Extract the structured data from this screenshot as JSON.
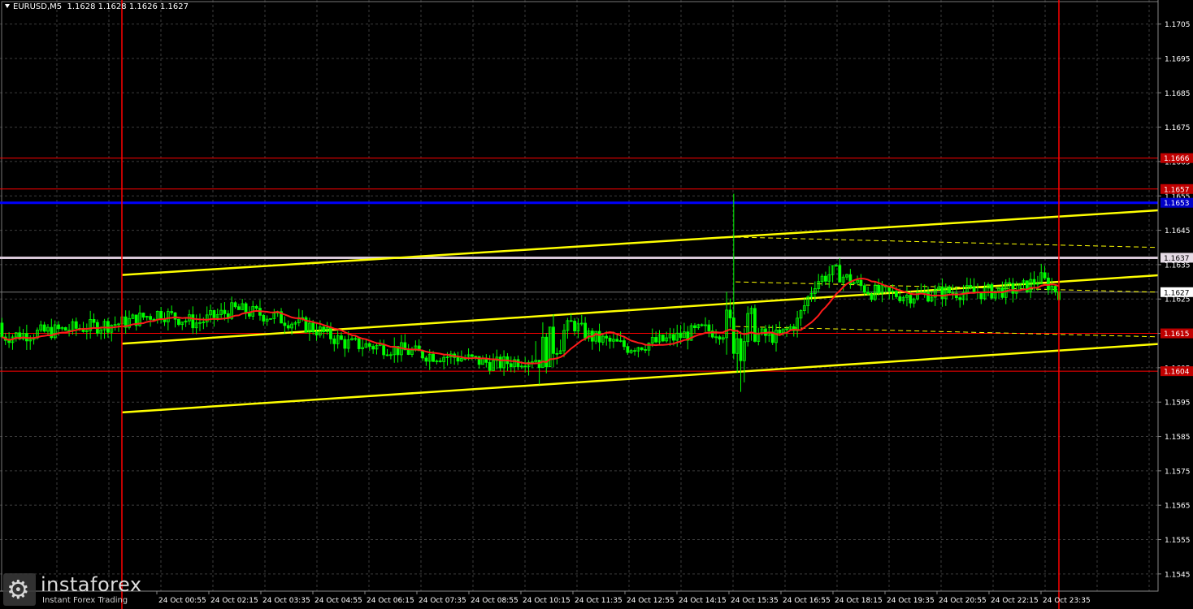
{
  "header": {
    "symbol": "EURUSD,M5",
    "ohlc": "1.1628 1.1628 1.1626 1.1627"
  },
  "logo": {
    "name": "instaforex",
    "tagline": "Instant Forex Trading"
  },
  "colors": {
    "background": "#000000",
    "grid": "#3c3c3c",
    "candle": "#00ff00",
    "moving_average": "#ff1a1a",
    "channel": "#ffff00",
    "level_red": "#ff0000",
    "level_blue": "#0000ff",
    "level_white": "#d8c8d8",
    "session_line": "#ff0000",
    "axis_text": "#ffffff"
  },
  "chart_data": {
    "type": "candlestick",
    "symbol": "EURUSD",
    "timeframe": "M5",
    "ylim": [
      1.154,
      1.1712
    ],
    "grid": true,
    "y_ticks": [
      "1.1705",
      "1.1695",
      "1.1685",
      "1.1675",
      "1.1665",
      "1.1655",
      "1.1645",
      "1.1635",
      "1.1625",
      "1.1615",
      "1.1605",
      "1.1595",
      "1.1585",
      "1.1575",
      "1.1565",
      "1.1555",
      "1.1545"
    ],
    "x_ticks": [
      "24 Oct 00:55",
      "24 Oct 02:15",
      "24 Oct 03:35",
      "24 Oct 04:55",
      "24 Oct 06:15",
      "24 Oct 07:35",
      "24 Oct 08:55",
      "24 Oct 10:15",
      "24 Oct 11:35",
      "24 Oct 12:55",
      "24 Oct 14:15",
      "24 Oct 15:35",
      "24 Oct 16:55",
      "24 Oct 18:15",
      "24 Oct 19:35",
      "24 Oct 20:55",
      "24 Oct 22:15",
      "24 Oct 23:35"
    ],
    "levels": [
      {
        "price": 1.1666,
        "label": "1.1666",
        "kind": "red"
      },
      {
        "price": 1.1657,
        "label": "1.1657",
        "kind": "red"
      },
      {
        "price": 1.1653,
        "label": "1.1653",
        "kind": "blue"
      },
      {
        "price": 1.1637,
        "label": "1.1637",
        "kind": "white"
      },
      {
        "price": 1.1627,
        "label": "1.1627",
        "kind": "current"
      },
      {
        "price": 1.1615,
        "label": "1.1615",
        "kind": "red"
      },
      {
        "price": 1.1604,
        "label": "1.1604",
        "kind": "red"
      }
    ],
    "channel_lines": [
      {
        "from": [
          0.0,
          1.1632
        ],
        "to": [
          1.0,
          1.1649
        ]
      },
      {
        "from": [
          0.0,
          1.1612
        ],
        "to": [
          1.0,
          1.163
        ]
      },
      {
        "from": [
          0.0,
          1.1592
        ],
        "to": [
          1.0,
          1.161
        ]
      }
    ],
    "session_markers": [
      0.0,
      1.0
    ],
    "price_path": [
      [
        0.0,
        1.1618
      ],
      [
        0.04,
        1.1621
      ],
      [
        0.08,
        1.1618
      ],
      [
        0.12,
        1.1622
      ],
      [
        0.16,
        1.162
      ],
      [
        0.2,
        1.1617
      ],
      [
        0.24,
        1.1612
      ],
      [
        0.28,
        1.1611
      ],
      [
        0.32,
        1.1609
      ],
      [
        0.36,
        1.1608
      ],
      [
        0.4,
        1.1606
      ],
      [
        0.44,
        1.1608
      ],
      [
        0.46,
        1.1612
      ],
      [
        0.48,
        1.1618
      ],
      [
        0.5,
        1.1614
      ],
      [
        0.54,
        1.1611
      ],
      [
        0.58,
        1.1613
      ],
      [
        0.62,
        1.1616
      ],
      [
        0.66,
        1.1615
      ],
      [
        0.7,
        1.1614
      ],
      [
        0.72,
        1.1618
      ],
      [
        0.74,
        1.163
      ],
      [
        0.76,
        1.1633
      ],
      [
        0.78,
        1.163
      ],
      [
        0.8,
        1.1627
      ],
      [
        0.84,
        1.1626
      ],
      [
        0.88,
        1.1627
      ],
      [
        0.92,
        1.1627
      ],
      [
        0.96,
        1.1628
      ],
      [
        0.98,
        1.1631
      ],
      [
        1.0,
        1.1627
      ]
    ]
  }
}
